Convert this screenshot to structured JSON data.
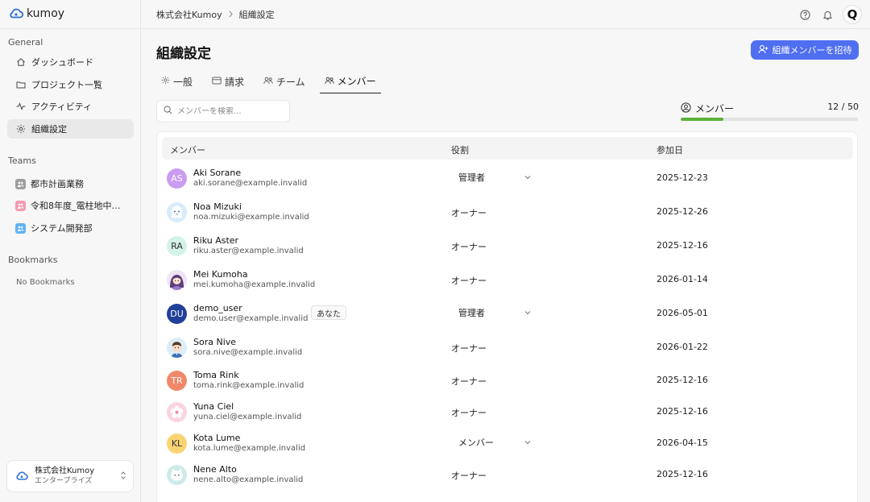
{
  "brand": {
    "name": "kumoy"
  },
  "sidebar": {
    "general_heading": "General",
    "nav": [
      {
        "label": "ダッシュボード",
        "icon": "home-icon",
        "active": false
      },
      {
        "label": "プロジェクト一覧",
        "icon": "folder-icon",
        "active": false
      },
      {
        "label": "アクティビティ",
        "icon": "activity-icon",
        "active": false
      },
      {
        "label": "組織設定",
        "icon": "gear-icon",
        "active": true
      }
    ],
    "teams_heading": "Teams",
    "teams": [
      {
        "label": "都市計画業務",
        "color": "#9e9e9e"
      },
      {
        "label": "令和8年度_電柱地中化...",
        "color": "#f59bb0"
      },
      {
        "label": "システム開発部",
        "color": "#5fb3f5"
      }
    ],
    "bookmarks_heading": "Bookmarks",
    "no_bookmarks": "No Bookmarks",
    "org": {
      "name": "株式会社Kumoy",
      "plan": "エンタープライズ"
    }
  },
  "topbar": {
    "breadcrumb": [
      "株式会社Kumoy",
      "組織設定"
    ],
    "user_initial": "Q"
  },
  "page": {
    "title": "組織設定",
    "invite_label": "組織メンバーを招待",
    "tabs": [
      {
        "label": "一般",
        "icon": "gear-icon",
        "active": false
      },
      {
        "label": "請求",
        "icon": "card-icon",
        "active": false
      },
      {
        "label": "チーム",
        "icon": "team-icon",
        "active": false
      },
      {
        "label": "メンバー",
        "icon": "members-icon",
        "active": true
      }
    ],
    "search_placeholder": "メンバーを検索...",
    "usage": {
      "label": "メンバー",
      "count": "12 / 50",
      "fraction": 0.24,
      "color": "#5ab33b"
    }
  },
  "table": {
    "headers": {
      "member": "メンバー",
      "role": "役割",
      "joined": "参加日"
    },
    "rows": [
      {
        "name": "Aki Sorane",
        "email": "aki.sorane@example.invalid",
        "role": "管理者",
        "editable": true,
        "joined": "2025-12-23",
        "avatar": {
          "type": "initials",
          "text": "AS",
          "bg": "#c99cf0",
          "fg": "#ffffff"
        }
      },
      {
        "name": "Noa Mizuki",
        "email": "noa.mizuki@example.invalid",
        "role": "オーナー",
        "editable": false,
        "joined": "2025-12-26",
        "avatar": {
          "type": "art",
          "art": "ghost",
          "bg": "#d7ecfb"
        }
      },
      {
        "name": "Riku Aster",
        "email": "riku.aster@example.invalid",
        "role": "オーナー",
        "editable": false,
        "joined": "2025-12-16",
        "avatar": {
          "type": "initials",
          "text": "RA",
          "bg": "#d3f2e8",
          "fg": "#333333"
        }
      },
      {
        "name": "Mei Kumoha",
        "email": "mei.kumoha@example.invalid",
        "role": "オーナー",
        "editable": false,
        "joined": "2026-01-14",
        "avatar": {
          "type": "art",
          "art": "girl",
          "bg": "#efe3f6"
        }
      },
      {
        "name": "demo_user",
        "email": "demo.user@example.invalid",
        "role": "管理者",
        "editable": true,
        "joined": "2026-05-01",
        "you": "あなた",
        "avatar": {
          "type": "initials",
          "text": "DU",
          "bg": "#21409a",
          "fg": "#ffffff"
        }
      },
      {
        "name": "Sora Nive",
        "email": "sora.nive@example.invalid",
        "role": "オーナー",
        "editable": false,
        "joined": "2026-01-22",
        "avatar": {
          "type": "art",
          "art": "boy",
          "bg": "#dcecf8"
        }
      },
      {
        "name": "Toma Rink",
        "email": "toma.rink@example.invalid",
        "role": "オーナー",
        "editable": false,
        "joined": "2025-12-16",
        "avatar": {
          "type": "initials",
          "text": "TR",
          "bg": "#f0886a",
          "fg": "#ffffff"
        }
      },
      {
        "name": "Yuna Ciel",
        "email": "yuna.ciel@example.invalid",
        "role": "オーナー",
        "editable": false,
        "joined": "2025-12-16",
        "avatar": {
          "type": "art",
          "art": "flower",
          "bg": "#fad3e1"
        }
      },
      {
        "name": "Kota Lume",
        "email": "kota.lume@example.invalid",
        "role": "メンバー",
        "editable": true,
        "joined": "2026-04-15",
        "avatar": {
          "type": "initials",
          "text": "KL",
          "bg": "#f9d572",
          "fg": "#333333"
        }
      },
      {
        "name": "Nene Alto",
        "email": "nene.alto@example.invalid",
        "role": "オーナー",
        "editable": false,
        "joined": "2025-12-16",
        "avatar": {
          "type": "art",
          "art": "cat",
          "bg": "#cdebe8"
        }
      }
    ]
  },
  "colors": {
    "accent": "#4f6ef0",
    "progress": "#5ab33b"
  }
}
